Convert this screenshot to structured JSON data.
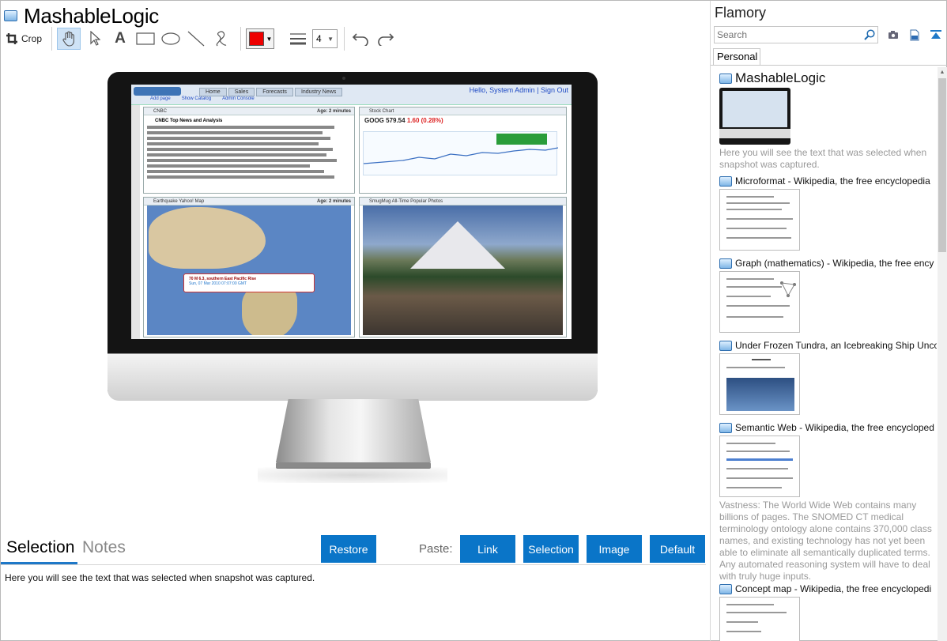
{
  "app": {
    "title": "MashableLogic"
  },
  "toolbar": {
    "crop_label": "Crop",
    "line_width_value": "4",
    "color_value": "#ee0000",
    "icons": [
      "crop-icon",
      "hand-icon",
      "pointer-icon",
      "text-icon",
      "rectangle-icon",
      "ellipse-icon",
      "line-icon",
      "freehand-icon",
      "line-width-icon",
      "undo-icon",
      "redo-icon"
    ]
  },
  "screenshot": {
    "screen": {
      "tabs": [
        "Home",
        "Sales",
        "Forecasts",
        "Industry News"
      ],
      "greeting": "Hello, System Admin | Sign Out",
      "links": [
        "Add page",
        "Show Catalog",
        "Admin Console"
      ],
      "cnbc_title": "CNBC",
      "cnbc_age": "Age: 2 minutes",
      "cnbc_headline": "CNBC Top News and Analysis",
      "stock_title": "Stock Chart",
      "stock_price": "GOOG 579.54",
      "stock_change": "1.60 (0.28%)",
      "map_title": "Earthquake Yahoo! Map",
      "map_age": "Age: 2 minutes",
      "map_popup": "70 M 6.3, southern East Pacific Rise",
      "map_popup_sub": "Sun, 07 Mar 2010 07:07:00 GMT",
      "photo_title": "SmugMug All-Time Popular Photos"
    }
  },
  "bottom": {
    "tab_selection": "Selection",
    "tab_notes": "Notes",
    "restore_label": "Restore",
    "paste_label": "Paste:",
    "link_label": "Link",
    "selection_label": "Selection",
    "image_label": "Image",
    "default_label": "Default",
    "selection_text": "Here you will see the text that was selected when snapshot was captured."
  },
  "sidebar": {
    "title": "Flamory",
    "search_placeholder": "Search",
    "tab_personal": "Personal",
    "items": [
      {
        "title": "MashableLogic",
        "desc": "Here you will see the text that was selected when snapshot was captured."
      },
      {
        "title": "Microformat - Wikipedia, the free encyclopedia",
        "desc": ""
      },
      {
        "title": "Graph (mathematics) - Wikipedia, the free ency",
        "desc": ""
      },
      {
        "title": "Under Frozen Tundra, an Icebreaking Ship Unco",
        "desc": ""
      },
      {
        "title": "Semantic Web - Wikipedia, the free encycloped",
        "desc": "Vastness: The World Wide Web contains many billions of pages. The SNOMED CT medical terminology ontology alone contains 370,000 class names, and existing technology has not yet been able to eliminate all semantically duplicated terms. Any automated reasoning system will have to deal with truly huge inputs."
      },
      {
        "title": "Concept map - Wikipedia, the free encyclopedi",
        "desc": ""
      }
    ]
  }
}
